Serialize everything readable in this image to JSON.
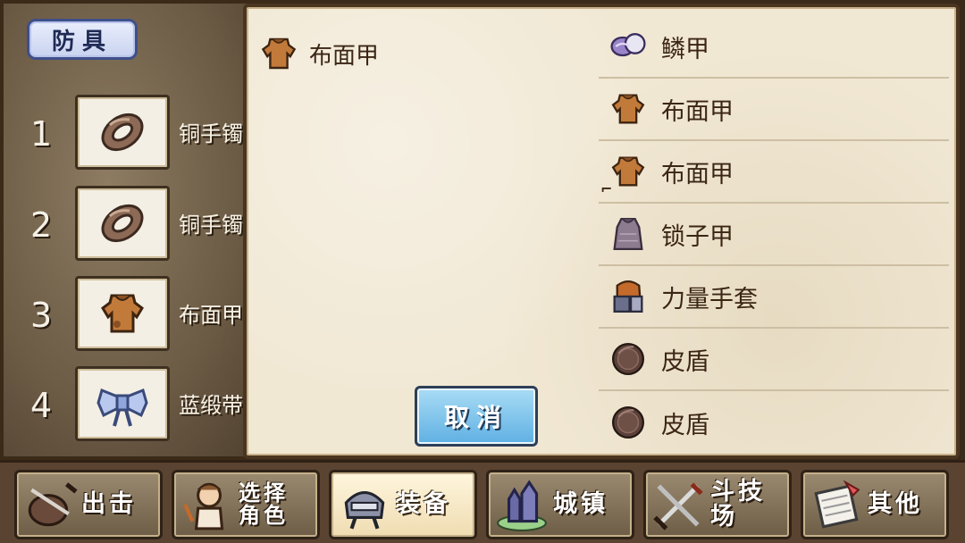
{
  "left_panel": {
    "title": "防具",
    "slots": [
      {
        "number": "1",
        "name": "铜手镯",
        "icon": "bracelet-icon"
      },
      {
        "number": "2",
        "name": "铜手镯",
        "icon": "bracelet-icon"
      },
      {
        "number": "3",
        "name": "布面甲",
        "icon": "cloth-armor-icon"
      },
      {
        "number": "4",
        "name": "蓝缎带",
        "icon": "blue-ribbon-icon"
      }
    ]
  },
  "selection_panel": {
    "current_item": {
      "name": "布面甲",
      "icon": "cloth-armor-icon"
    },
    "items": [
      {
        "name": "鳞甲",
        "icon": "scale-armor-icon"
      },
      {
        "name": "布面甲",
        "icon": "cloth-armor-icon"
      },
      {
        "name": "布面甲",
        "icon": "cloth-armor-icon",
        "selected": true
      },
      {
        "name": "锁子甲",
        "icon": "chainmail-icon"
      },
      {
        "name": "力量手套",
        "icon": "power-gloves-icon"
      },
      {
        "name": "皮盾",
        "icon": "leather-shield-icon"
      },
      {
        "name": "皮盾",
        "icon": "leather-shield-icon"
      }
    ],
    "cancel_label": "取消"
  },
  "menu": {
    "buttons": [
      {
        "label": "出击",
        "icon": "sortie-icon"
      },
      {
        "label_line1": "选择",
        "label_line2": "角色",
        "icon": "character-icon"
      },
      {
        "label": "装备",
        "icon": "armor-equip-icon",
        "active": true
      },
      {
        "label": "城镇",
        "icon": "castle-icon"
      },
      {
        "label": "斗技场",
        "icon": "arena-swords-icon"
      },
      {
        "label": "其他",
        "icon": "scroll-icon"
      }
    ]
  }
}
